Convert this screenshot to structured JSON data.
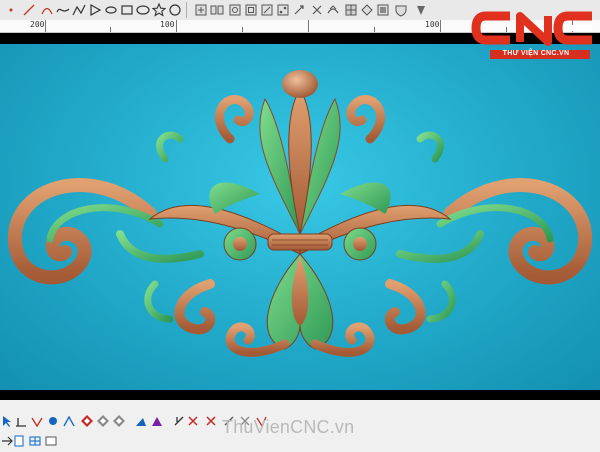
{
  "ruler": {
    "labels": [
      "200",
      "100",
      "100"
    ]
  },
  "logo": {
    "letters": "CNC",
    "caption": "THƯ VIỆN CNC.VN"
  },
  "watermark": "ThuVienCNC.vn",
  "colors": {
    "canvas": "#21a8c8",
    "logo_red": "#d62e1f",
    "carving_copper": "#c87a4a",
    "carving_green": "#4fb86a"
  },
  "toolbar_top": {
    "icons": [
      "point-icon",
      "line-icon",
      "arc-icon",
      "polyline-icon",
      "curve-icon",
      "triangle-icon",
      "ellipse-icon",
      "rectangle-icon",
      "oval-icon",
      "star-icon",
      "circle-icon",
      "move-icon",
      "mirror-icon",
      "array-icon",
      "offset-icon",
      "trim-icon",
      "node-icon",
      "scale-icon",
      "rotate-icon",
      "smooth-icon",
      "fill-icon",
      "shield-icon",
      "tool-icon"
    ]
  },
  "toolbar_bottom": {
    "icons": [
      "select-icon",
      "measure-icon",
      "warp-icon",
      "sphere-icon",
      "curve-tool-icon",
      "shaded-view-icon",
      "wire-view-icon",
      "flat-view-icon",
      "relief-icon",
      "sculpt-icon",
      "cut-icon",
      "erase-icon",
      "delete-icon",
      "file-icon",
      "layer-icon",
      "table-icon"
    ]
  }
}
